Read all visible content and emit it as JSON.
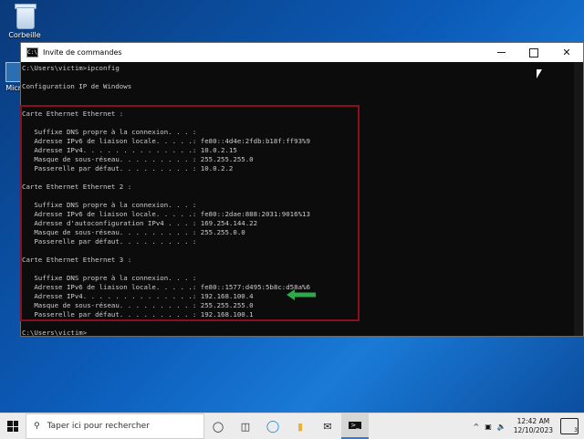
{
  "desktop": {
    "recycle_bin": "Corbeille",
    "edge_label": "Micro"
  },
  "window": {
    "title": "Invite de commandes",
    "icon_text": "C:\\"
  },
  "console_lines": [
    "C:\\Users\\victim>ipconfig",
    "",
    "Configuration IP de Windows",
    "",
    "",
    "Carte Ethernet Ethernet :",
    "",
    "   Suffixe DNS propre à la connexion. . . :",
    "   Adresse IPv6 de liaison locale. . . . .: fe80::4d4e:2fdb:b18f:ff93%9",
    "   Adresse IPv4. . . . . . . . . . . . . .: 10.0.2.15",
    "   Masque de sous-réseau. . . . . . . . . : 255.255.255.0",
    "   Passerelle par défaut. . . . . . . . . : 10.0.2.2",
    "",
    "Carte Ethernet Ethernet 2 :",
    "",
    "   Suffixe DNS propre à la connexion. . . :",
    "   Adresse IPv6 de liaison locale. . . . .: fe80::2dae:888:2031:9016%13",
    "   Adresse d'autoconfiguration IPv4 . . . : 169.254.144.22",
    "   Masque de sous-réseau. . . . . . . . . : 255.255.0.0",
    "   Passerelle par défaut. . . . . . . . . :",
    "",
    "Carte Ethernet Ethernet 3 :",
    "",
    "   Suffixe DNS propre à la connexion. . . :",
    "   Adresse IPv6 de liaison locale. . . . .: fe80::1577:d495:5b8c:d58a%6",
    "   Adresse IPv4. . . . . . . . . . . . . .: 192.168.100.4",
    "   Masque de sous-réseau. . . . . . . . . : 255.255.255.0",
    "   Passerelle par défaut. . . . . . . . . : 192.168.100.1",
    "",
    "C:\\Users\\victim>"
  ],
  "annotation": {
    "box_color": "#8a1020",
    "arrow_color": "#2ea84a"
  },
  "taskbar": {
    "search_placeholder": "Taper ici pour rechercher",
    "time": "12:42 AM",
    "date": "12/10/2023",
    "notification_count": "3"
  }
}
